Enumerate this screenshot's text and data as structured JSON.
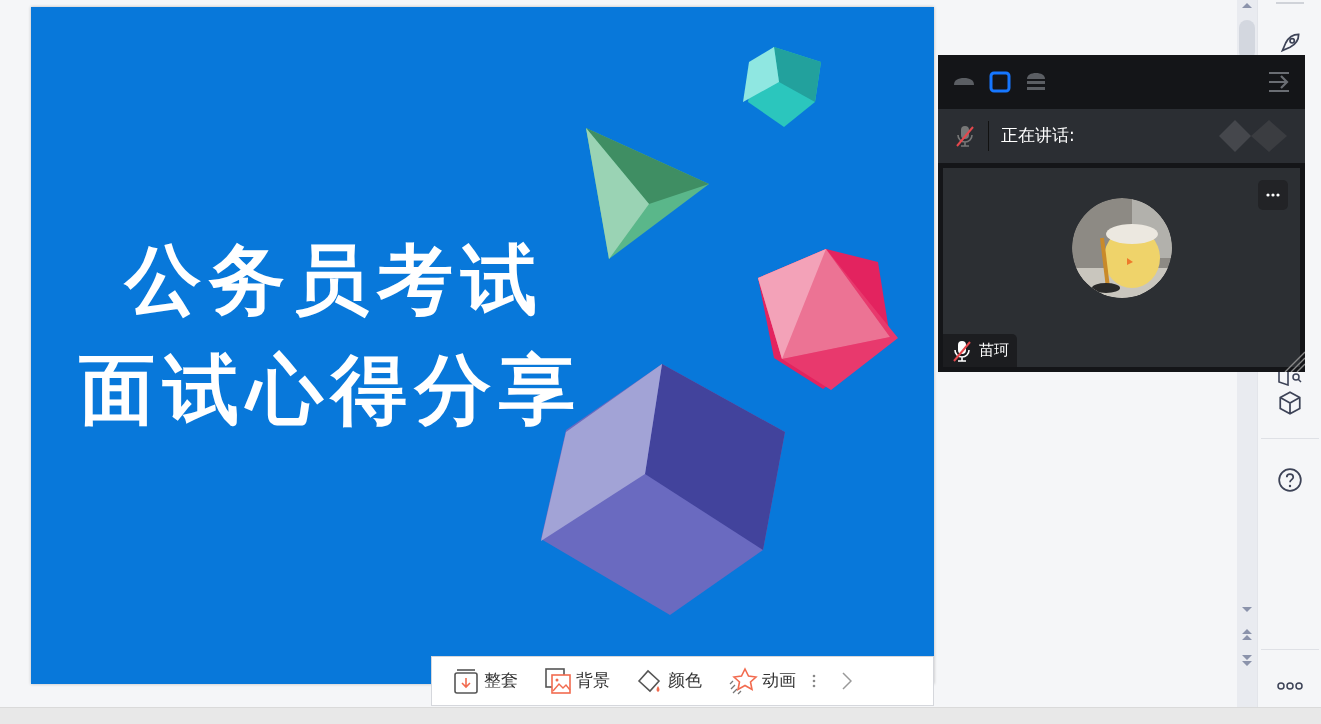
{
  "slide": {
    "title_lines": [
      "公务员考试",
      "面试心得分享"
    ]
  },
  "slide_toolbar": {
    "buttons": [
      {
        "kind": "set",
        "label": "整套"
      },
      {
        "kind": "background",
        "label": "背景"
      },
      {
        "kind": "color",
        "label": "颜色"
      },
      {
        "kind": "animation",
        "label": "动画"
      }
    ]
  },
  "meeting": {
    "view_modes": [
      {
        "kind": "mini",
        "selected": false
      },
      {
        "kind": "single",
        "selected": true
      },
      {
        "kind": "list",
        "selected": false
      }
    ],
    "speaking": {
      "muted": true,
      "label": "正在讲话:"
    },
    "participant": {
      "name": "苗珂",
      "muted": true
    }
  }
}
